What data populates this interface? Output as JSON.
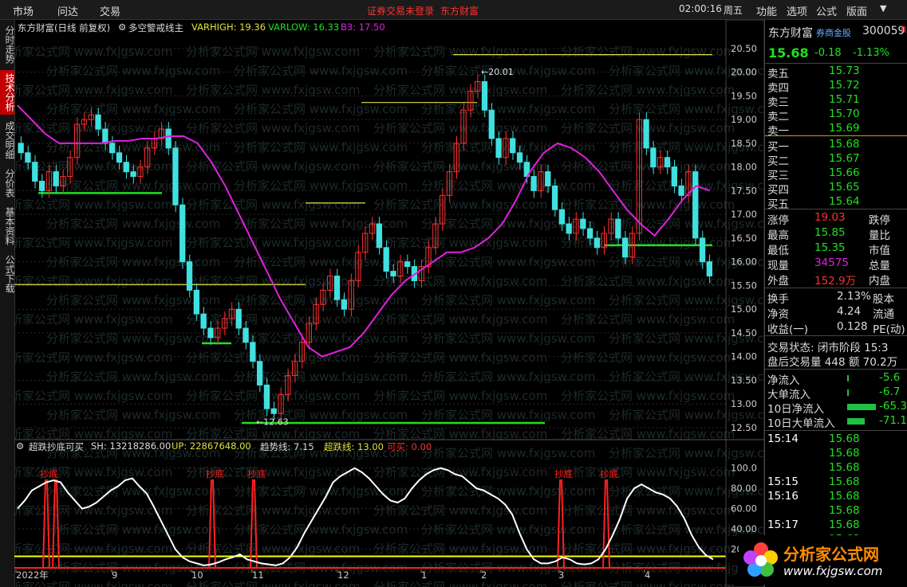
{
  "topbar": {
    "menus": [
      "市场",
      "问达",
      "交易"
    ],
    "alert": "证券交易未登录",
    "brand": "东方财富",
    "time": "02:00:16",
    "weekday": "周五",
    "right_menus": [
      "功能",
      "选项",
      "公式",
      "版面"
    ]
  },
  "sidebar_tabs": [
    "分时走势",
    "技术分析",
    "成交明细",
    "分价表",
    "基本资料",
    "公式下载"
  ],
  "main_chart_header": {
    "stock": "东方财富(日线 前复权)",
    "indicator": "多空警戒线主",
    "varhigh": "VARHIGH: 19.36",
    "varlow": "VARLOW: 16.33",
    "b3": "B3: 17.50"
  },
  "sub_chart_header": {
    "name": "超跌抄底可买",
    "sh": "SH: 13218286.00",
    "up": "UP: 22867648.00",
    "trend": "趋势线: 7.15",
    "oversold": "超跌线: 13.00",
    "buy": "可买: 0.00"
  },
  "watermark": "分析家公式网 www.fxjgsw.com",
  "colors": {
    "up": "#ff3030",
    "down": "#40e0e0",
    "ma": "#e020e0",
    "support": "#20e020",
    "resist": "#e0e040",
    "osc": "#ffffff",
    "signal": "#ff2020",
    "threshold": "#ffff00"
  },
  "chart_data": [
    {
      "type": "candlestick",
      "title": "东方财富(日线 前复权)",
      "ylim": [
        12.5,
        20.8
      ],
      "y_ticks": [
        "20.50",
        "20.00",
        "19.50",
        "19.00",
        "18.50",
        "18.00",
        "17.50",
        "17.00",
        "16.50",
        "16.00",
        "15.50",
        "15.00",
        "14.50",
        "14.00",
        "13.50",
        "13.00",
        "12.50"
      ],
      "x_ticks": [
        "2022年",
        "9",
        "10",
        "11",
        "12",
        "1",
        "2",
        "3",
        "4"
      ],
      "annotations": [
        {
          "text": "20.01",
          "value": 20.01
        },
        {
          "text": "12.63",
          "value": 12.63
        }
      ],
      "closes": [
        18.3,
        18.1,
        17.7,
        17.5,
        17.9,
        17.6,
        17.8,
        18.2,
        18.9,
        19.0,
        19.1,
        18.8,
        18.5,
        18.3,
        18.1,
        17.9,
        17.8,
        18.0,
        18.4,
        18.6,
        18.8,
        18.4,
        17.2,
        16.0,
        15.4,
        14.9,
        14.6,
        14.4,
        14.6,
        14.8,
        15.0,
        14.6,
        14.3,
        13.9,
        13.4,
        12.9,
        12.8,
        13.2,
        13.6,
        13.9,
        14.3,
        14.7,
        15.1,
        15.4,
        15.7,
        15.2,
        15.0,
        15.6,
        16.2,
        16.6,
        16.8,
        16.3,
        15.8,
        15.7,
        16.0,
        15.9,
        15.6,
        15.9,
        16.3,
        16.8,
        17.4,
        17.9,
        18.5,
        19.2,
        19.6,
        19.8,
        19.2,
        18.6,
        18.2,
        18.6,
        18.3,
        18.1,
        17.8,
        17.5,
        17.9,
        17.6,
        17.1,
        16.8,
        16.6,
        16.9,
        16.7,
        16.5,
        16.3,
        16.6,
        16.9,
        16.5,
        16.1,
        16.6,
        19.0,
        18.4,
        18.0,
        18.2,
        18.0,
        17.6,
        17.4,
        17.9,
        16.5,
        16.0,
        15.7
      ],
      "ma_line": [
        19.3,
        19.0,
        18.7,
        18.5,
        18.5,
        18.5,
        18.5,
        18.55,
        18.55,
        18.6,
        18.6,
        18.65,
        18.65,
        18.5,
        18.1,
        17.6,
        17.0,
        16.4,
        15.8,
        15.2,
        14.7,
        14.2,
        14.0,
        14.1,
        14.2,
        14.5,
        14.9,
        15.3,
        15.6,
        15.8,
        16.0,
        16.2,
        16.2,
        16.3,
        16.5,
        16.8,
        17.3,
        17.9,
        18.3,
        18.5,
        18.4,
        18.2,
        17.9,
        17.5,
        17.1,
        16.8,
        16.55,
        16.9,
        17.3,
        17.6,
        17.5
      ],
      "levels": [
        {
          "name": "support",
          "value": 17.45
        },
        {
          "name": "support",
          "value": 14.28
        },
        {
          "name": "support",
          "value": 12.6
        },
        {
          "name": "support",
          "value": 16.35
        },
        {
          "name": "resist",
          "value": 20.37
        },
        {
          "name": "resist",
          "value": 19.36
        },
        {
          "name": "resist",
          "value": 17.24
        },
        {
          "name": "resist",
          "value": 15.52
        }
      ]
    },
    {
      "type": "line",
      "title": "超跌抄底可买",
      "ylim": [
        0,
        110
      ],
      "y_ticks": [
        "100.0",
        "80.00",
        "60.00",
        "40.00",
        "20.00"
      ],
      "series": [
        {
          "name": "超跌抄底可买",
          "values": [
            60,
            68,
            78,
            82,
            86,
            88,
            86,
            76,
            68,
            60,
            62,
            66,
            72,
            78,
            82,
            88,
            90,
            82,
            75,
            62,
            48,
            34,
            20,
            12,
            8,
            6,
            4,
            5,
            7,
            10,
            12,
            15,
            10,
            8,
            6,
            5,
            4,
            6,
            12,
            22,
            36,
            48,
            60,
            72,
            86,
            92,
            96,
            100,
            96,
            90,
            82,
            74,
            68,
            66,
            70,
            80,
            88,
            94,
            98,
            100,
            98,
            94,
            92,
            86,
            80,
            78,
            74,
            70,
            64,
            54,
            36,
            20,
            10,
            6,
            6,
            8,
            12,
            10,
            6,
            5,
            6,
            10,
            20,
            34,
            50,
            70,
            80,
            84,
            80,
            76,
            74,
            70,
            62,
            50,
            34,
            22,
            14,
            10
          ]
        }
      ],
      "threshold": 13.0,
      "signals": [
        "抄底",
        "抄底",
        "抄底",
        "抄底",
        "抄底",
        "抄底"
      ]
    }
  ],
  "quote": {
    "name": "东方财富",
    "badge": "券商金股",
    "code": "300059",
    "price": "15.68",
    "change": "-0.18",
    "pct": "-1.13%",
    "asks": [
      [
        "卖五",
        "15.73"
      ],
      [
        "卖四",
        "15.72"
      ],
      [
        "卖三",
        "15.71"
      ],
      [
        "卖二",
        "15.70"
      ],
      [
        "卖一",
        "15.69"
      ]
    ],
    "bids": [
      [
        "买一",
        "15.68"
      ],
      [
        "买二",
        "15.67"
      ],
      [
        "买三",
        "15.66"
      ],
      [
        "买四",
        "15.65"
      ],
      [
        "买五",
        "15.64"
      ]
    ],
    "stats": [
      [
        "涨停",
        "19.03",
        "跌停"
      ],
      [
        "最高",
        "15.85",
        "量比"
      ],
      [
        "最低",
        "15.35",
        "市值"
      ],
      [
        "现量",
        "34575",
        "总量"
      ],
      [
        "外盘",
        "152.9万",
        "内盘"
      ]
    ],
    "stats2": [
      [
        "换手",
        "2.13%",
        "股本"
      ],
      [
        "净资",
        "4.24",
        "流通"
      ],
      [
        "收益(一)",
        "0.128",
        "PE(动)"
      ]
    ],
    "trade_status": "交易状态: 闭市阶段 15:3",
    "after_hours": "盘后交易量 448 额 70.2万",
    "flows": [
      [
        "净流入",
        "-5.6"
      ],
      [
        "大单流入",
        "-6.7"
      ],
      [
        "10日净流入",
        "-65.3"
      ],
      [
        "10日大单流入",
        "-71.1"
      ]
    ],
    "ticks": [
      [
        "15:14",
        "15.68"
      ],
      [
        "",
        "15.68"
      ],
      [
        "",
        "15.68"
      ],
      [
        "15:15",
        "15.68"
      ],
      [
        "15:16",
        "15.68"
      ],
      [
        "",
        "15.68"
      ],
      [
        "15:17",
        "15.68"
      ],
      [
        "",
        "15.68"
      ]
    ],
    "footer_logo": "分析家公式网",
    "footer_url": "www.fxjgsw.com"
  }
}
